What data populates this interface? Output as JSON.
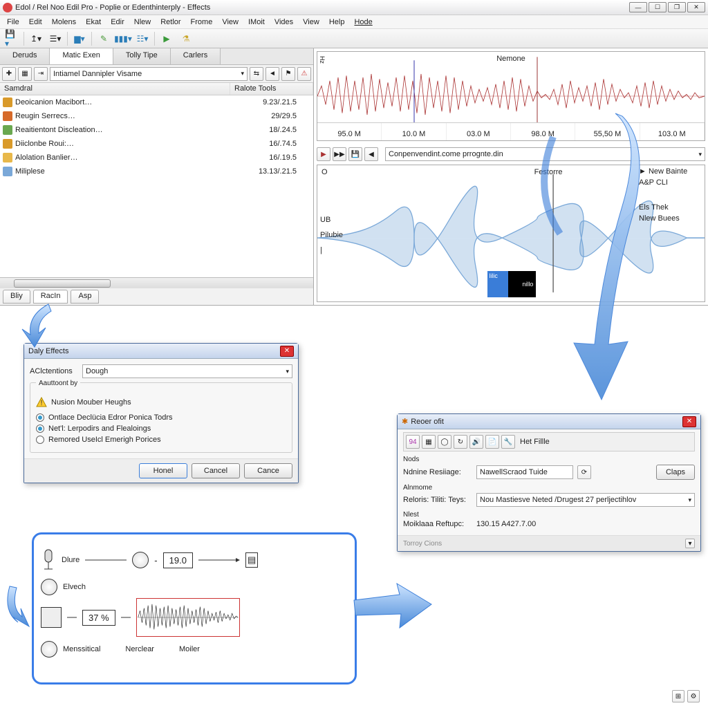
{
  "title": "Edol / Rel Noo Edil Pro - Poplie or Edenthinterply - Effects",
  "menus": [
    "File",
    "Edit",
    "Molens",
    "Ekat",
    "Edir",
    "Nlew",
    "Retlor",
    "Frome",
    "View",
    "IMoit",
    "Vides",
    "View",
    "Help",
    "Hode"
  ],
  "tabs": {
    "items": [
      "Deruds",
      "Matic Exen",
      "Tolly Tipe",
      "Carlers"
    ],
    "active": 1
  },
  "projectCombo": "Intiamel Dannipler Visame",
  "listHeader": {
    "c1": "Samdral",
    "c2": "Ralote Tools"
  },
  "rows": [
    {
      "ic": "#d99a2a",
      "nm": "Deoicanion Macibort…",
      "vl": "9.23/.21.5"
    },
    {
      "ic": "#d66a2a",
      "nm": "Reugin Serrecs…",
      "vl": "29/29.5"
    },
    {
      "ic": "#6aa84f",
      "nm": "Reaitientont Discleation…",
      "vl": "18/.24.5"
    },
    {
      "ic": "#d99a2a",
      "nm": "Diiclonbe Roui:…",
      "vl": "16/.74.5"
    },
    {
      "ic": "#e8b84a",
      "nm": "Alolation Banlier…",
      "vl": "16/.19.5"
    },
    {
      "ic": "#7aa8d8",
      "nm": "Miliplese",
      "vl": "13.13/.21.5"
    }
  ],
  "bottomTabs": {
    "items": [
      "Bliy",
      "RacIn",
      "Asp"
    ],
    "active": 1
  },
  "waveTitle": "Nemone",
  "waveY": "Hz",
  "ruler": [
    "95.0 M",
    "10.0 M",
    "03.0 M",
    "98.0 M",
    "55,50 M",
    "103.0 M"
  ],
  "presetCombo": "Conpenvendint.come prrognte.din",
  "specLblO": "O",
  "specLblFeature": "Festorre",
  "spec": {
    "ub": "UB",
    "pilubie": "Pilubie",
    "bar": "|"
  },
  "minimap": {
    "a": "lilic",
    "b": "nillo"
  },
  "side": {
    "newBainte": "New Bainte",
    "apcli": "A&P CLI",
    "etsnek": "Els Thek",
    "nbuees": "Nlew Buees",
    "arrow": "►"
  },
  "dlg1": {
    "title": "Daly Effects",
    "lblAct": "AClctentions",
    "act": "Dough",
    "leg": "Aauttoont by",
    "warn": "Nusion Mouber Heughs",
    "r1": "Ontlace Declücia Edror Ponica Todrs",
    "r2": "Net'l: Lerpodirs and Flealoings",
    "r3": "Remored UseIcl Emerigh Porices",
    "btnOk": "Honel",
    "btnCancel": "Cancel",
    "btnCance": "Cance"
  },
  "dlg2": {
    "title": "Reoer ofit",
    "toolbarHet": "Het Fillle",
    "lblNods": "Nods",
    "lblRes": "Ndnine Resiiage:",
    "res": "NawellScraod Tuide",
    "btnClaps": "Claps",
    "lblAlm": "Alnmome",
    "lblRel": "Reloris: Tiliti: Teys:",
    "rel": "Nou Mastiesve Neted /Drugest 27 perljectihlov",
    "lblNlest": "Nlest",
    "lblMR": "Moiklaaa Reftupc:",
    "mr": "130.15 A427.7.00",
    "footer": "Torroy Cions"
  },
  "sig": {
    "dlure": "Dlure",
    "val1": "19.0",
    "elvech": "Elvech",
    "val2": "37 %",
    "mens": "Menssitical",
    "nerclear": "Nerclear",
    "moiler": "Moiler"
  }
}
